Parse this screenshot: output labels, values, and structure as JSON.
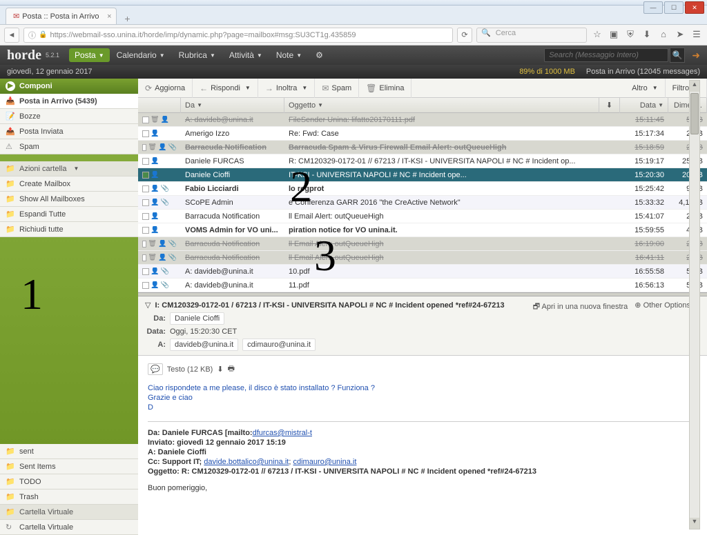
{
  "browser": {
    "tab_title": "Posta :: Posta in Arrivo",
    "url": "https://webmail-sso.unina.it/horde/imp/dynamic.php?page=mailbox#msg:SU3CT1g.435859",
    "search_placeholder": "Cerca"
  },
  "horde": {
    "logo": "horde",
    "version": "5.2.1",
    "menu": {
      "posta": "Posta",
      "calendario": "Calendario",
      "rubrica": "Rubrica",
      "attivita": "Attività",
      "note": "Note"
    },
    "search_placeholder": "Search (Messaggio Intero)"
  },
  "status": {
    "date": "giovedì, 12 gennaio 2017",
    "quota": "89% di 1000 MB",
    "folder_status": "Posta in Arrivo (12045 messages)"
  },
  "sidebar": {
    "compose": "Componi",
    "folders": {
      "inbox": "Posta in Arrivo (5439)",
      "bozze": "Bozze",
      "inviata": "Posta Inviata",
      "spam": "Spam"
    },
    "actions_header": "Azioni cartella",
    "actions": {
      "create": "Create Mailbox",
      "showall": "Show All Mailboxes",
      "espandi": "Espandi Tutte",
      "richiudi": "Richiudi tutte"
    },
    "lower": {
      "sent": "sent",
      "sentitems": "Sent Items",
      "todo": "TODO",
      "trash": "Trash",
      "cartella_virtuale_hdr": "Cartella Virtuale",
      "cartella_virtuale": "Cartella Virtuale"
    }
  },
  "toolbar": {
    "aggiorna": "Aggiorna",
    "rispondi": "Rispondi",
    "inoltra": "Inoltra",
    "spam": "Spam",
    "elimina": "Elimina",
    "altro": "Altro",
    "filtro": "Filtro"
  },
  "columns": {
    "da": "Da",
    "oggetto": "Oggetto",
    "data": "Data",
    "dimen": "Dimen..."
  },
  "messages": [
    {
      "from": "A: davideb@unina.it",
      "subject": "FileSender Unina: lifatto20170111.pdf",
      "date": "15:11:45",
      "size": "5 KB",
      "state": "del"
    },
    {
      "from": "Amerigo Izzo",
      "subject": "Re: Fwd: Case",
      "date": "15:17:34",
      "size": "2 KB",
      "state": ""
    },
    {
      "from": "Barracuda Notification",
      "subject": "Barracuda Spam & Virus Firewall Email Alert: outQueueHigh",
      "date": "15:18:59",
      "size": "2 KB",
      "state": "del bold",
      "attach": true
    },
    {
      "from": "Daniele FURCAS",
      "subject": "R: CM120329-0172-01 // 67213 / IT-KSI - UNIVERSITA NAPOLI # NC # Incident op...",
      "date": "15:19:17",
      "size": "25 KB",
      "state": ""
    },
    {
      "from": "Daniele Cioffi",
      "subject": "IT-KSI - UNIVERSITA NAPOLI # NC # Incident ope...",
      "date": "15:20:30",
      "size": "20 KB",
      "state": "sel"
    },
    {
      "from": "Fabio Licciardi",
      "subject": "lo regprot",
      "date": "15:25:42",
      "size": "9 KB",
      "state": "bold",
      "attach": true
    },
    {
      "from": "SCoPE Admin",
      "subject": "e Conferenza GARR 2016 \"the CreActive Network\"",
      "date": "15:33:32",
      "size": "4,1 MB",
      "state": "alt",
      "attach": true
    },
    {
      "from": "Barracuda Notification",
      "subject": "ll Email Alert: outQueueHigh",
      "date": "15:41:07",
      "size": "2 KB",
      "state": ""
    },
    {
      "from": "VOMS Admin for VO uni...",
      "subject": "piration notice for VO unina.it.",
      "date": "15:59:55",
      "size": "4 KB",
      "state": "bold"
    },
    {
      "from": "Barracuda Notification",
      "subject": "ll Email Alert: outQueueHigh",
      "date": "16:19:00",
      "size": "2 KB",
      "state": "del",
      "attach": true
    },
    {
      "from": "Barracuda Notification",
      "subject": "ll Email Alert: outQueueHigh",
      "date": "16:41:11",
      "size": "2 KB",
      "state": "del",
      "attach": true
    },
    {
      "from": "A: davideb@unina.it",
      "subject": "10.pdf",
      "date": "16:55:58",
      "size": "5 KB",
      "state": "alt",
      "attach": true
    },
    {
      "from": "A: davideb@unina.it",
      "subject": "11.pdf",
      "date": "16:56:13",
      "size": "5 KB",
      "state": "",
      "attach": true
    }
  ],
  "preview": {
    "subject": "I: CM120329-0172-01 / 67213 / IT-KSI - UNIVERSITA NAPOLI # NC # Incident opened *ref#24-67213",
    "open_new": "Apri in una nuova finestra",
    "other_opts": "Other Options",
    "da_label": "Da:",
    "da_value": "Daniele Cioffi",
    "data_label": "Data:",
    "data_value": "Oggi, 15:20:30 CET",
    "a_label": "A:",
    "a_value1": "davideb@unina.it",
    "a_value2": "cdimauro@unina.it",
    "text_part": "Testo (12 KB)",
    "body_line1": "Ciao rispondete a me please, il disco è stato installato ? Funziona ?",
    "body_line2": "Grazie e ciao",
    "body_line3": "D",
    "q_da": "Da: Daniele FURCAS [mailto:",
    "q_da_link": "dfurcas@mistral-t",
    "q_inviato": "Inviato: giovedì 12 gennaio 2017 15:19",
    "q_a": "A: Daniele Cioffi",
    "q_cc_label": "Cc: Support IT; ",
    "q_cc_link1": "davide.bottalico@unina.it",
    "q_cc_sep": "; ",
    "q_cc_link2": "cdimauro@unina.it",
    "q_oggetto": "Oggetto: R: CM120329-0172-01 // 67213 / IT-KSI - UNIVERSITA NAPOLI # NC # Incident opened *ref#24-67213",
    "q_buon": "Buon pomeriggio,"
  },
  "annotations": {
    "one": "1",
    "two": "2",
    "three": "3"
  }
}
